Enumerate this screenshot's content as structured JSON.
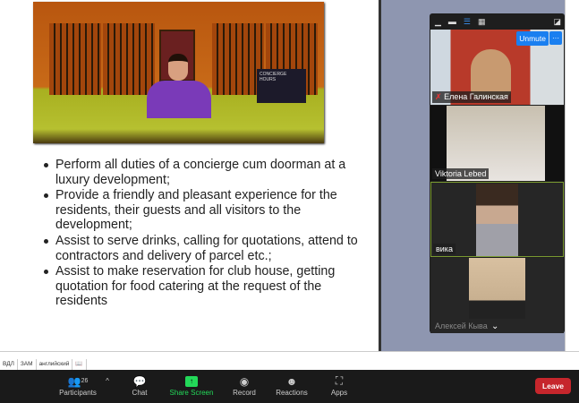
{
  "slide": {
    "sign_text": "CONCIERGE HOURS",
    "bullets": [
      "Perform all duties of a concierge cum doorman at a luxury development;",
      "Provide a friendly and pleasant experience for the residents, their guests and all visitors to the development;",
      "Assist to serve drinks, calling for quotations, attend to contractors and delivery of parcel etc.;",
      "Assist to make reservation for club house, getting quotation for food catering at the request of the residents"
    ]
  },
  "video_panel": {
    "unmute_label": "Unmute",
    "more_label": "···",
    "participants": [
      {
        "name": "Елена Галинская",
        "muted": true
      },
      {
        "name": "Viktoria Lebed"
      },
      {
        "name": "вика",
        "active": true
      },
      {
        "name": "Алексей Кыва"
      }
    ]
  },
  "status_bar": [
    "ВДЛ",
    "ЗАМ",
    "английский",
    "📖"
  ],
  "toolbar": {
    "participants_label": "Participants",
    "participants_count": "26",
    "chat_label": "Chat",
    "share_label": "Share Screen",
    "record_label": "Record",
    "reactions_label": "Reactions",
    "apps_label": "Apps",
    "leave_label": "Leave"
  },
  "colors": {
    "share": "#23d959",
    "leave": "#c6262c",
    "unmute": "#1a7ff0",
    "active_border": "#7a9a30"
  }
}
